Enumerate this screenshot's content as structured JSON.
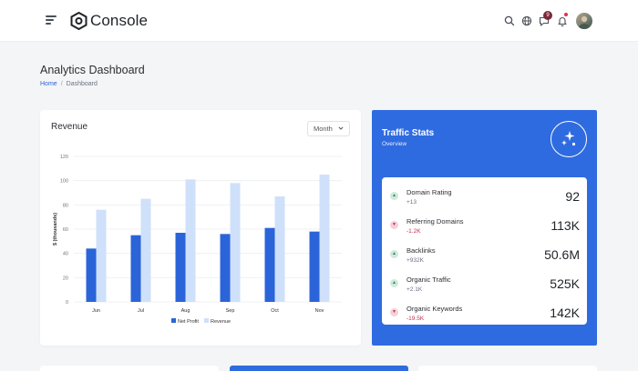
{
  "header": {
    "brand": "Console",
    "notification_badge": "9"
  },
  "page": {
    "title": "Analytics Dashboard",
    "breadcrumb": {
      "home": "Home",
      "separator": "/",
      "current": "Dashboard"
    }
  },
  "revenue": {
    "title": "Revenue",
    "period_select": "Month"
  },
  "chart_data": {
    "type": "bar",
    "categories": [
      "Jun",
      "Jul",
      "Aug",
      "Sep",
      "Oct",
      "Nov"
    ],
    "series": [
      {
        "name": "Net Profit",
        "values": [
          44,
          55,
          57,
          56,
          61,
          58
        ],
        "color": "#2a64d8"
      },
      {
        "name": "Revenue",
        "values": [
          76,
          85,
          101,
          98,
          87,
          105
        ],
        "color": "#cfe0fa"
      }
    ],
    "ylabel": "$ (thousands)",
    "ylim": [
      0,
      120
    ],
    "yticks": [
      0,
      20,
      40,
      60,
      80,
      100,
      120
    ],
    "grid": true,
    "legend": "bottom"
  },
  "traffic": {
    "title": "Traffic Stats",
    "subtitle": "Overview",
    "items": [
      {
        "label": "Domain Rating",
        "change": "+13",
        "value": "92",
        "trend": "up"
      },
      {
        "label": "Referring Domains",
        "change": "-1.2K",
        "value": "113K",
        "trend": "down"
      },
      {
        "label": "Backlinks",
        "change": "+932K",
        "value": "50.6M",
        "trend": "up"
      },
      {
        "label": "Organic Traffic",
        "change": "+2.1K",
        "value": "525K",
        "trend": "up"
      },
      {
        "label": "Organic Keywords",
        "change": "-19.5K",
        "value": "142K",
        "trend": "down"
      }
    ]
  },
  "colors": {
    "accent": "#2f6be0",
    "net_profit": "#2a64d8",
    "revenue": "#cfe0fa",
    "positive_bg": "#cfe9dc",
    "negative_bg": "#f6d0d8"
  }
}
